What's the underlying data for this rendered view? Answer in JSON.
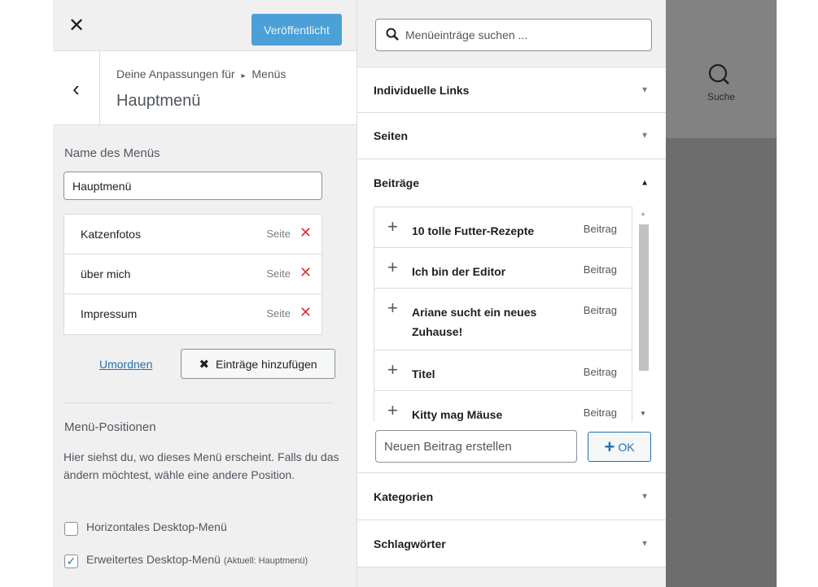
{
  "header": {
    "close_icon": "close-icon",
    "publish_label": "Veröffentlicht"
  },
  "title_section": {
    "breadcrumb_prefix": "Deine Anpassungen für",
    "breadcrumb_arrow": "▸",
    "breadcrumb_section": "Menüs",
    "menu_title": "Hauptmenü"
  },
  "menu_name": {
    "label": "Name des Menüs",
    "value": "Hauptmenü"
  },
  "menu_items": [
    {
      "title": "Katzenfotos",
      "type": "Seite"
    },
    {
      "title": "über mich",
      "type": "Seite"
    },
    {
      "title": "Impressum",
      "type": "Seite"
    }
  ],
  "actions": {
    "reorder_label": "Umordnen",
    "add_items_label": "Einträge hinzufügen"
  },
  "positions": {
    "heading": "Menü-Positionen",
    "description": "Hier siehst du, wo dieses Menü erscheint. Falls du das ändern möchtest, wähle eine andere Position.",
    "options": [
      {
        "label": "Horizontales Desktop-Menü",
        "checked": false,
        "note": ""
      },
      {
        "label": "Erweitertes Desktop-Menü",
        "checked": true,
        "note": "(Aktuell: Hauptmenü)"
      }
    ]
  },
  "available": {
    "search_placeholder": "Menüeinträge suchen ...",
    "sections": {
      "custom_links": "Individuelle Links",
      "pages": "Seiten",
      "posts": "Beiträge",
      "categories": "Kategorien",
      "tags": "Schlagwörter"
    },
    "posts": [
      {
        "title": "10 tolle Futter-Rezepte",
        "type": "Beitrag"
      },
      {
        "title": "Ich bin der Editor",
        "type": "Beitrag"
      },
      {
        "title": "Ariane sucht ein neues Zuhause!",
        "type": "Beitrag"
      },
      {
        "title": "Titel",
        "type": "Beitrag"
      },
      {
        "title": "Kitty mag Mäuse",
        "type": "Beitrag"
      }
    ],
    "new_post_placeholder": "Neuen Beitrag erstellen",
    "ok_label": "OK"
  },
  "preview": {
    "search_label": "Suche"
  },
  "colors": {
    "accent": "#2271b1",
    "publish": "#4ba0d8",
    "delete": "#d63638",
    "panel_bg": "#f0f0f1"
  }
}
